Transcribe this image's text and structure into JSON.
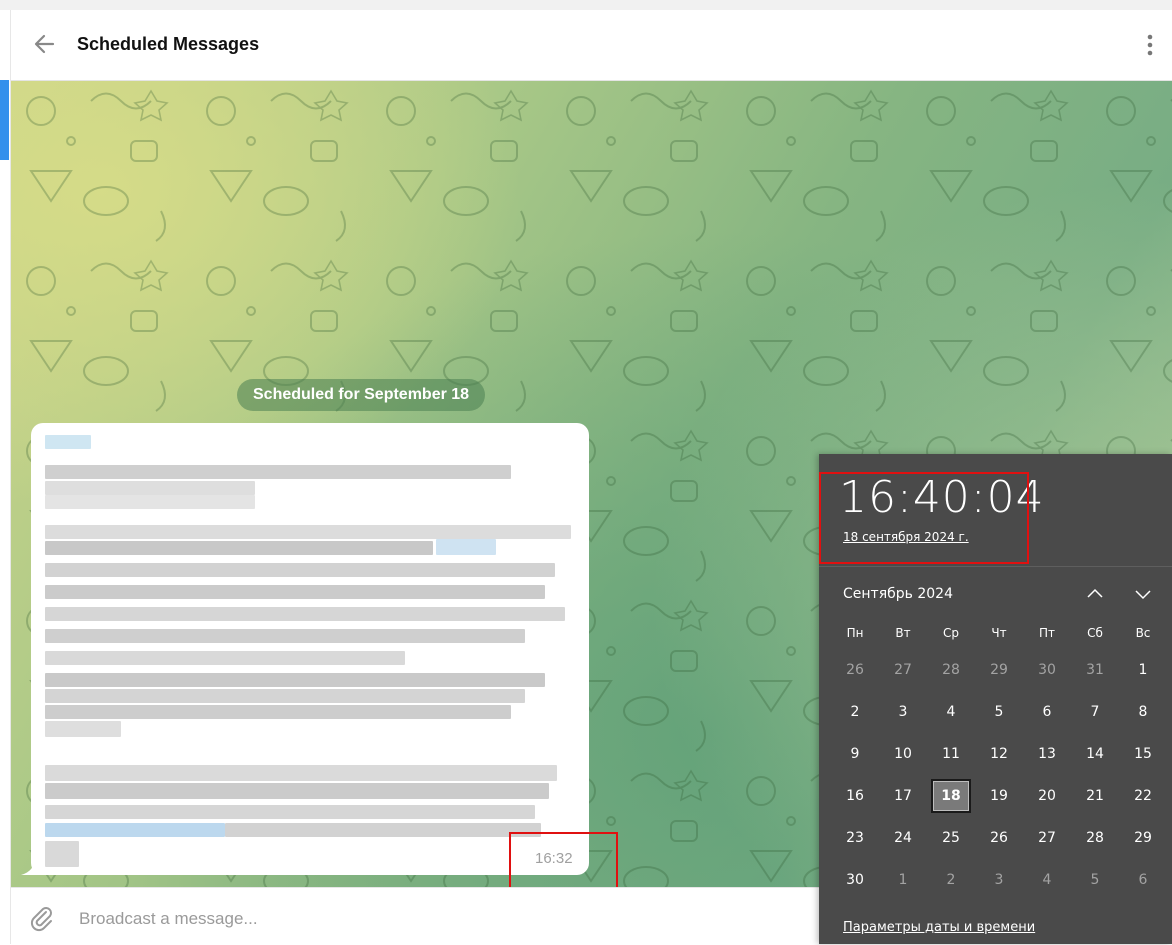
{
  "header": {
    "title": "Scheduled Messages"
  },
  "chat": {
    "date_pill": "Scheduled for September 18",
    "message": {
      "time": "16:32"
    }
  },
  "composer": {
    "placeholder": "Broadcast a message..."
  },
  "clock_flyout": {
    "time": "16:40:04",
    "long_date": "18 сентября 2024 г.",
    "month_label": "Сентябрь 2024",
    "weekdays": [
      "Пн",
      "Вт",
      "Ср",
      "Чт",
      "Пт",
      "Сб",
      "Вс"
    ],
    "weeks": [
      [
        "26",
        "27",
        "28",
        "29",
        "30",
        "31",
        "1"
      ],
      [
        "2",
        "3",
        "4",
        "5",
        "6",
        "7",
        "8"
      ],
      [
        "9",
        "10",
        "11",
        "12",
        "13",
        "14",
        "15"
      ],
      [
        "16",
        "17",
        "18",
        "19",
        "20",
        "21",
        "22"
      ],
      [
        "23",
        "24",
        "25",
        "26",
        "27",
        "28",
        "29"
      ],
      [
        "30",
        "1",
        "2",
        "3",
        "4",
        "5",
        "6"
      ]
    ],
    "selected_day": "18",
    "settings_link": "Параметры даты и времени"
  },
  "colors": {
    "accent": "#3390ec",
    "highlight_box": "#e01010",
    "flyout_bg": "#4a4a4a"
  },
  "icons": [
    "back-arrow-icon",
    "more-vertical-icon",
    "paperclip-icon",
    "chevron-up-icon",
    "chevron-down-icon"
  ]
}
